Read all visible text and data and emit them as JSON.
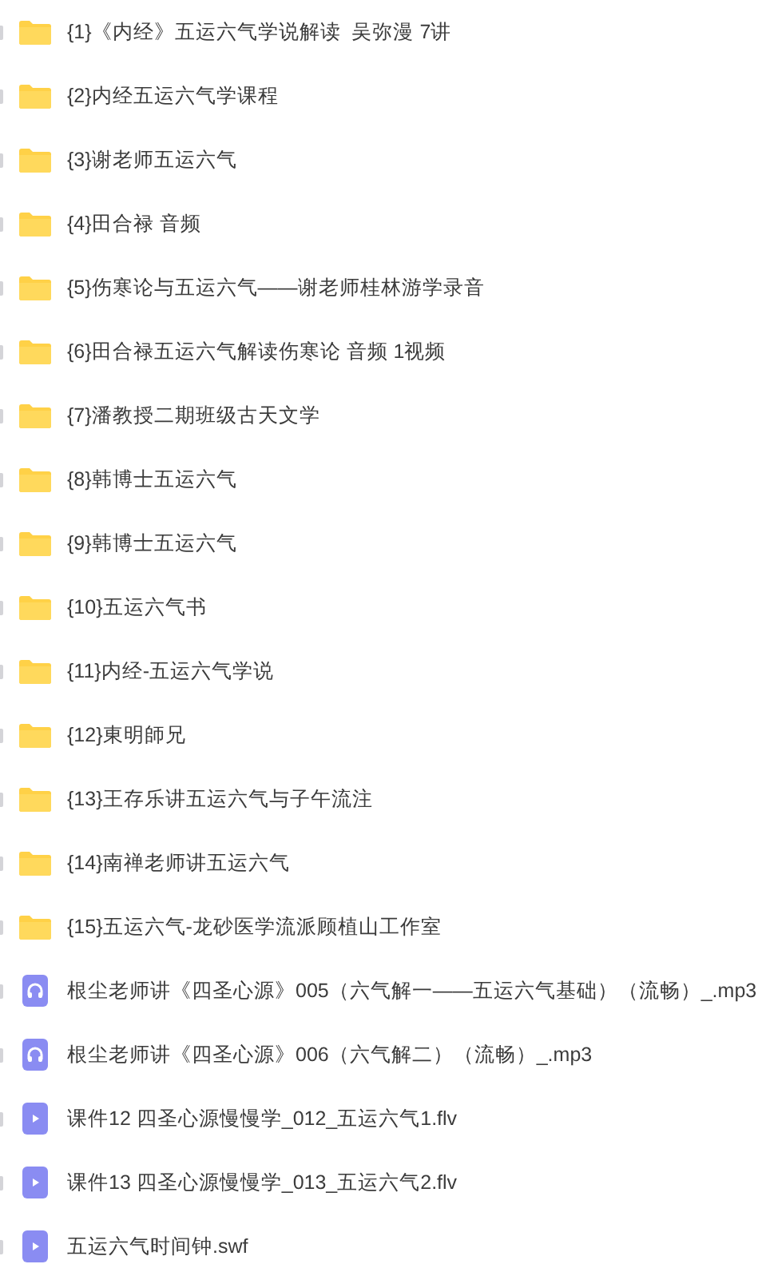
{
  "files": [
    {
      "kind": "folder",
      "name": "{1}《内经》五运六气学说解读  吴弥漫 7讲"
    },
    {
      "kind": "folder",
      "name": "{2}内经五运六气学课程"
    },
    {
      "kind": "folder",
      "name": "{3}谢老师五运六气"
    },
    {
      "kind": "folder",
      "name": "{4}田合禄 音频"
    },
    {
      "kind": "folder",
      "name": "{5}伤寒论与五运六气——谢老师桂林游学录音"
    },
    {
      "kind": "folder",
      "name": "{6}田合禄五运六气解读伤寒论 音频 1视频"
    },
    {
      "kind": "folder",
      "name": "{7}潘教授二期班级古天文学"
    },
    {
      "kind": "folder",
      "name": "{8}韩博士五运六气"
    },
    {
      "kind": "folder",
      "name": "{9}韩博士五运六气"
    },
    {
      "kind": "folder",
      "name": "{10}五运六气书"
    },
    {
      "kind": "folder",
      "name": "{11}内经-五运六气学说"
    },
    {
      "kind": "folder",
      "name": "{12}東明師兄"
    },
    {
      "kind": "folder",
      "name": "{13}王存乐讲五运六气与子午流注"
    },
    {
      "kind": "folder",
      "name": "{14}南禅老师讲五运六气"
    },
    {
      "kind": "folder",
      "name": "{15}五运六气-龙砂医学流派顾植山工作室"
    },
    {
      "kind": "audio",
      "name": "根尘老师讲《四圣心源》005（六气解一——五运六气基础）（流畅）_.mp3"
    },
    {
      "kind": "audio",
      "name": "根尘老师讲《四圣心源》006（六气解二）（流畅）_.mp3"
    },
    {
      "kind": "video",
      "name": "课件12 四圣心源慢慢学_012_五运六气1.flv"
    },
    {
      "kind": "video",
      "name": "课件13 四圣心源慢慢学_013_五运六气2.flv"
    },
    {
      "kind": "video",
      "name": "五运六气时间钟.swf"
    }
  ]
}
